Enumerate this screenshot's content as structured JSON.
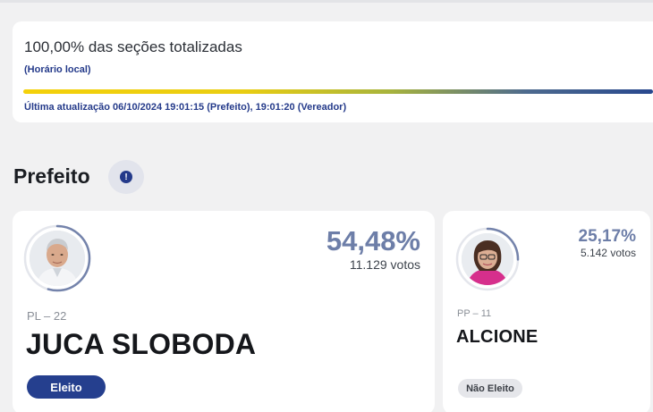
{
  "status": {
    "title": "100,00% das seções totalizadas",
    "note": "(Horário local)",
    "progress": 1.0,
    "last_update": "Última atualização 06/10/2024 19:01:15 (Prefeito), 19:01:20 (Vereador)"
  },
  "section": {
    "title": "Prefeito",
    "info_icon": "info-icon",
    "info_glyph": "!"
  },
  "candidates": [
    {
      "name": "JUCA SLOBODA",
      "party": "PL – 22",
      "percent": "54,48%",
      "votes": "11.129 votos",
      "status": "Eleito",
      "ring_fraction": 0.5448
    },
    {
      "name": "ALCIONE",
      "party": "PP – 11",
      "percent": "25,17%",
      "votes": "5.142 votos",
      "status": "Não Eleito",
      "ring_fraction": 0.2517
    }
  ],
  "colors": {
    "accent": "#253f8e",
    "percent": "#6d7ea8",
    "ring": "#7483ab",
    "progress_start": "#f4d10a",
    "progress_end": "#28488e"
  }
}
